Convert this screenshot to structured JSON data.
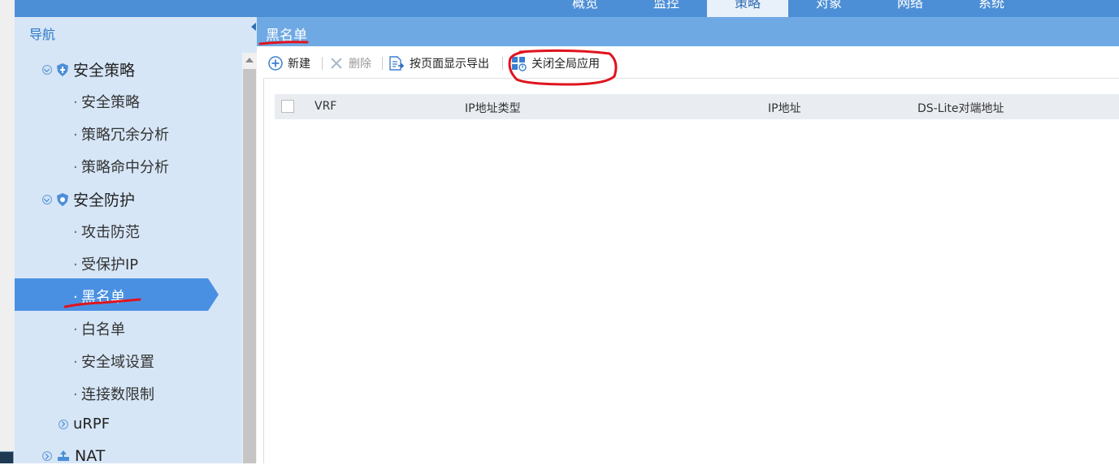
{
  "topnav": {
    "tabs": [
      {
        "label": "概览",
        "active": false
      },
      {
        "label": "监控",
        "active": false
      },
      {
        "label": "策略",
        "active": true
      },
      {
        "label": "对象",
        "active": false
      },
      {
        "label": "网络",
        "active": false
      },
      {
        "label": "系统",
        "active": false
      }
    ]
  },
  "sidebar": {
    "title": "导航",
    "groups": [
      {
        "label": "安全策略",
        "icon": "shield-icon",
        "expanded": true
      },
      {
        "label": "安全防护",
        "icon": "shield-icon",
        "expanded": true
      },
      {
        "label": "uRPF",
        "icon": "",
        "expanded": false
      },
      {
        "label": "NAT",
        "icon": "nat-icon",
        "expanded": false
      }
    ],
    "items": [
      {
        "label": "安全策略"
      },
      {
        "label": "策略冗余分析"
      },
      {
        "label": "策略命中分析"
      },
      {
        "label": "攻击防范"
      },
      {
        "label": "受保护IP"
      },
      {
        "label": "黑名单"
      },
      {
        "label": "白名单"
      },
      {
        "label": "安全域设置"
      },
      {
        "label": "连接数限制"
      }
    ],
    "selected": "黑名单"
  },
  "breadcrumb": {
    "title": "黑名单"
  },
  "toolbar": {
    "new_label": "新建",
    "delete_label": "删除",
    "export_label": "按页面显示导出",
    "global_label": "关闭全局应用"
  },
  "table": {
    "columns": [
      "VRF",
      "IP地址类型",
      "IP地址",
      "DS-Lite对端地址"
    ]
  },
  "colors": {
    "topbar": "#4d8fd6",
    "sidebar": "#d6e6f7",
    "selected": "#4a90e2",
    "annotation": "#e0141e"
  }
}
